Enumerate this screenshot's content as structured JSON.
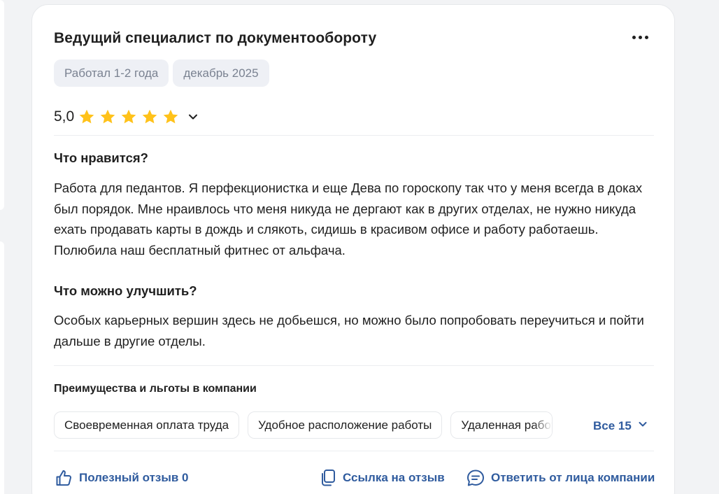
{
  "review": {
    "title": "Ведущий специалист по документообороту",
    "tags": [
      "Работал 1-2 года",
      "декабрь 2025"
    ],
    "rating": {
      "value_text": "5,0",
      "stars": 5,
      "max_stars": 5
    },
    "likes": {
      "heading": "Что нравится?",
      "text": "Работа для педантов. Я перфекционистка и еще Дева по гороскопу так что у меня всегда в доках был порядок. Мне нраивлось что меня никуда не дергают как в других отделах, не нужно никуда ехать продавать карты в дождь и слякоть, сидишь в красивом офисе и работу работаешь. Полюбила наш бесплатный фитнес от альфача."
    },
    "improve": {
      "heading": "Что можно улучшить?",
      "text": "Особых карьерных вершин здесь не добьешся, но можно было попробовать переучиться и пойти дальше в другие отделы."
    },
    "benefits": {
      "heading": "Преимущества и льготы в компании",
      "chips": [
        "Своевременная оплата труда",
        "Удобное расположение работы",
        "Удаленная работа"
      ],
      "all_label": "Все 15"
    },
    "actions": {
      "helpful": "Полезный отзыв 0",
      "link": "Ссылка на отзыв",
      "reply": "Ответить от лица компании"
    }
  },
  "colors": {
    "star": "#ffc21a",
    "link": "#2f5b9e",
    "tag_bg": "#eef0f5",
    "tag_text": "#7a8291"
  },
  "icons": [
    "more-dots-icon",
    "star-icon",
    "chevron-down-icon",
    "thumb-up-icon",
    "copy-link-icon",
    "chat-reply-icon"
  ]
}
